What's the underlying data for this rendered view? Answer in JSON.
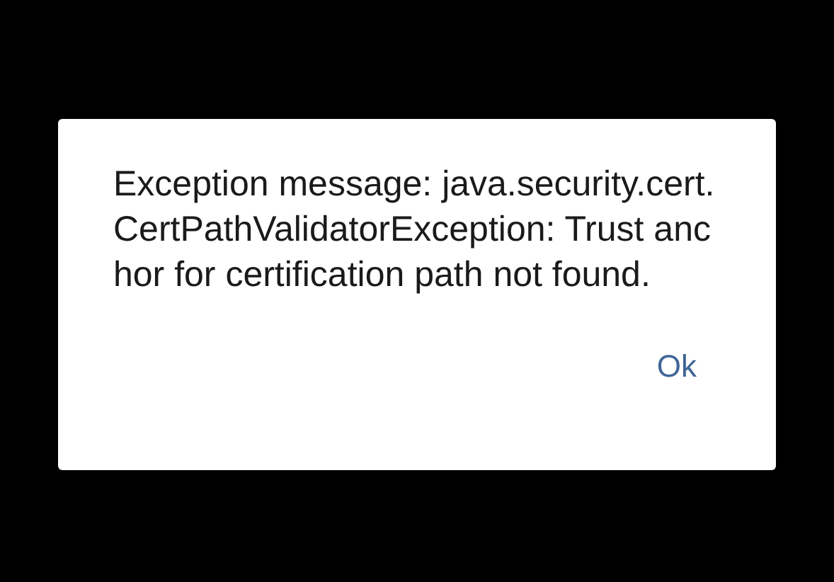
{
  "dialog": {
    "message": "Exception message: java.security.cert.CertPathValidatorException: Trust anchor for certification path not found.",
    "buttons": [
      {
        "label": "Ok"
      }
    ]
  }
}
